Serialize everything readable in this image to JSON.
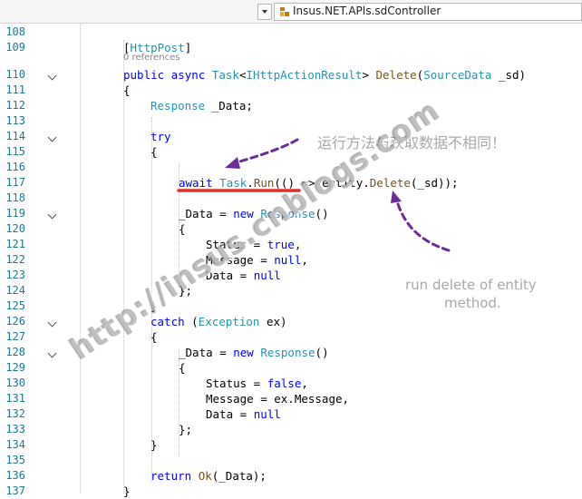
{
  "toolbar": {
    "class_selector": "Insus.NET.APIs.sdController",
    "colors": {
      "background": "#f5f5f5",
      "border": "#d6d6d6"
    }
  },
  "editor": {
    "codelens": "0 references",
    "lines": [
      {
        "num": "108",
        "indent": 0,
        "fold": false,
        "segments": []
      },
      {
        "num": "109",
        "indent": 2,
        "fold": false,
        "segments": [
          {
            "t": "[",
            "c": "pl"
          },
          {
            "t": "HttpPost",
            "c": "ty"
          },
          {
            "t": "]",
            "c": "pl"
          }
        ]
      },
      {
        "num": "110",
        "indent": 2,
        "fold": true,
        "segments": [
          {
            "t": "public",
            "c": "kw"
          },
          {
            "t": " ",
            "c": "pl"
          },
          {
            "t": "async",
            "c": "kw"
          },
          {
            "t": " ",
            "c": "pl"
          },
          {
            "t": "Task",
            "c": "ty"
          },
          {
            "t": "<",
            "c": "pl"
          },
          {
            "t": "IHttpActionResult",
            "c": "ty"
          },
          {
            "t": "> ",
            "c": "pl"
          },
          {
            "t": "Delete",
            "c": "mt"
          },
          {
            "t": "(",
            "c": "pl"
          },
          {
            "t": "SourceData",
            "c": "ty"
          },
          {
            "t": " _sd)",
            "c": "pl"
          }
        ]
      },
      {
        "num": "111",
        "indent": 2,
        "fold": false,
        "segments": [
          {
            "t": "{",
            "c": "pl"
          }
        ]
      },
      {
        "num": "112",
        "indent": 3,
        "fold": false,
        "segments": [
          {
            "t": "Response",
            "c": "ty"
          },
          {
            "t": " _Data;",
            "c": "pl"
          }
        ]
      },
      {
        "num": "113",
        "indent": 0,
        "fold": false,
        "segments": []
      },
      {
        "num": "114",
        "indent": 3,
        "fold": true,
        "segments": [
          {
            "t": "try",
            "c": "kw"
          }
        ]
      },
      {
        "num": "115",
        "indent": 3,
        "fold": false,
        "segments": [
          {
            "t": "{",
            "c": "pl"
          }
        ]
      },
      {
        "num": "116",
        "indent": 0,
        "fold": false,
        "segments": []
      },
      {
        "num": "117",
        "indent": 4,
        "fold": false,
        "segments": [
          {
            "t": "await",
            "c": "kw"
          },
          {
            "t": " ",
            "c": "pl"
          },
          {
            "t": "Task",
            "c": "ty"
          },
          {
            "t": ".",
            "c": "pl"
          },
          {
            "t": "Run",
            "c": "mt"
          },
          {
            "t": "(() => entity.",
            "c": "pl"
          },
          {
            "t": "Delete",
            "c": "mt"
          },
          {
            "t": "(_sd));",
            "c": "pl"
          }
        ]
      },
      {
        "num": "118",
        "indent": 0,
        "fold": false,
        "segments": []
      },
      {
        "num": "119",
        "indent": 4,
        "fold": true,
        "segments": [
          {
            "t": "_Data = ",
            "c": "pl"
          },
          {
            "t": "new",
            "c": "kw"
          },
          {
            "t": " ",
            "c": "pl"
          },
          {
            "t": "Response",
            "c": "ty"
          },
          {
            "t": "()",
            "c": "pl"
          }
        ]
      },
      {
        "num": "120",
        "indent": 4,
        "fold": false,
        "segments": [
          {
            "t": "{",
            "c": "pl"
          }
        ]
      },
      {
        "num": "121",
        "indent": 5,
        "fold": false,
        "segments": [
          {
            "t": "Status = ",
            "c": "pl"
          },
          {
            "t": "true",
            "c": "kw"
          },
          {
            "t": ",",
            "c": "pl"
          }
        ]
      },
      {
        "num": "122",
        "indent": 5,
        "fold": false,
        "segments": [
          {
            "t": "Message = ",
            "c": "pl"
          },
          {
            "t": "null",
            "c": "kw"
          },
          {
            "t": ",",
            "c": "pl"
          }
        ]
      },
      {
        "num": "123",
        "indent": 5,
        "fold": false,
        "segments": [
          {
            "t": "Data = ",
            "c": "pl"
          },
          {
            "t": "null",
            "c": "kw"
          }
        ]
      },
      {
        "num": "124",
        "indent": 4,
        "fold": false,
        "segments": [
          {
            "t": "};",
            "c": "pl"
          }
        ]
      },
      {
        "num": "125",
        "indent": 3,
        "fold": false,
        "segments": [
          {
            "t": "}",
            "c": "pl"
          }
        ]
      },
      {
        "num": "126",
        "indent": 3,
        "fold": true,
        "segments": [
          {
            "t": "catch",
            "c": "kw"
          },
          {
            "t": " (",
            "c": "pl"
          },
          {
            "t": "Exception",
            "c": "ty"
          },
          {
            "t": " ex)",
            "c": "pl"
          }
        ]
      },
      {
        "num": "127",
        "indent": 3,
        "fold": false,
        "segments": [
          {
            "t": "{",
            "c": "pl"
          }
        ]
      },
      {
        "num": "128",
        "indent": 4,
        "fold": true,
        "segments": [
          {
            "t": "_Data = ",
            "c": "pl"
          },
          {
            "t": "new",
            "c": "kw"
          },
          {
            "t": " ",
            "c": "pl"
          },
          {
            "t": "Response",
            "c": "ty"
          },
          {
            "t": "()",
            "c": "pl"
          }
        ]
      },
      {
        "num": "129",
        "indent": 4,
        "fold": false,
        "segments": [
          {
            "t": "{",
            "c": "pl"
          }
        ]
      },
      {
        "num": "130",
        "indent": 5,
        "fold": false,
        "segments": [
          {
            "t": "Status = ",
            "c": "pl"
          },
          {
            "t": "false",
            "c": "kw"
          },
          {
            "t": ",",
            "c": "pl"
          }
        ]
      },
      {
        "num": "131",
        "indent": 5,
        "fold": false,
        "segments": [
          {
            "t": "Message = ex.Message,",
            "c": "pl"
          }
        ]
      },
      {
        "num": "132",
        "indent": 5,
        "fold": false,
        "segments": [
          {
            "t": "Data = ",
            "c": "pl"
          },
          {
            "t": "null",
            "c": "kw"
          }
        ]
      },
      {
        "num": "133",
        "indent": 4,
        "fold": false,
        "segments": [
          {
            "t": "};",
            "c": "pl"
          }
        ]
      },
      {
        "num": "134",
        "indent": 3,
        "fold": false,
        "segments": [
          {
            "t": "}",
            "c": "pl"
          }
        ]
      },
      {
        "num": "135",
        "indent": 0,
        "fold": false,
        "segments": []
      },
      {
        "num": "136",
        "indent": 3,
        "fold": false,
        "segments": [
          {
            "t": "return",
            "c": "kw"
          },
          {
            "t": " ",
            "c": "pl"
          },
          {
            "t": "Ok",
            "c": "mt"
          },
          {
            "t": "(_Data);",
            "c": "pl"
          }
        ]
      },
      {
        "num": "137",
        "indent": 2,
        "fold": false,
        "segments": [
          {
            "t": "}",
            "c": "pl"
          }
        ]
      }
    ],
    "colors": {
      "keyword": "#0000ff",
      "type": "#2b91af",
      "method": "#74531f",
      "line_number": "#237893"
    }
  },
  "annotations": {
    "chinese_note": "运行方法与获取数据不相同！",
    "english_note_line1": "run delete of entity",
    "english_note_line2": "method.",
    "watermark": "http://insus.cnblogs.com",
    "colors": {
      "arrow": "#6a2d9a",
      "underline": "#e0302a",
      "note": "#a9a9a9"
    }
  }
}
